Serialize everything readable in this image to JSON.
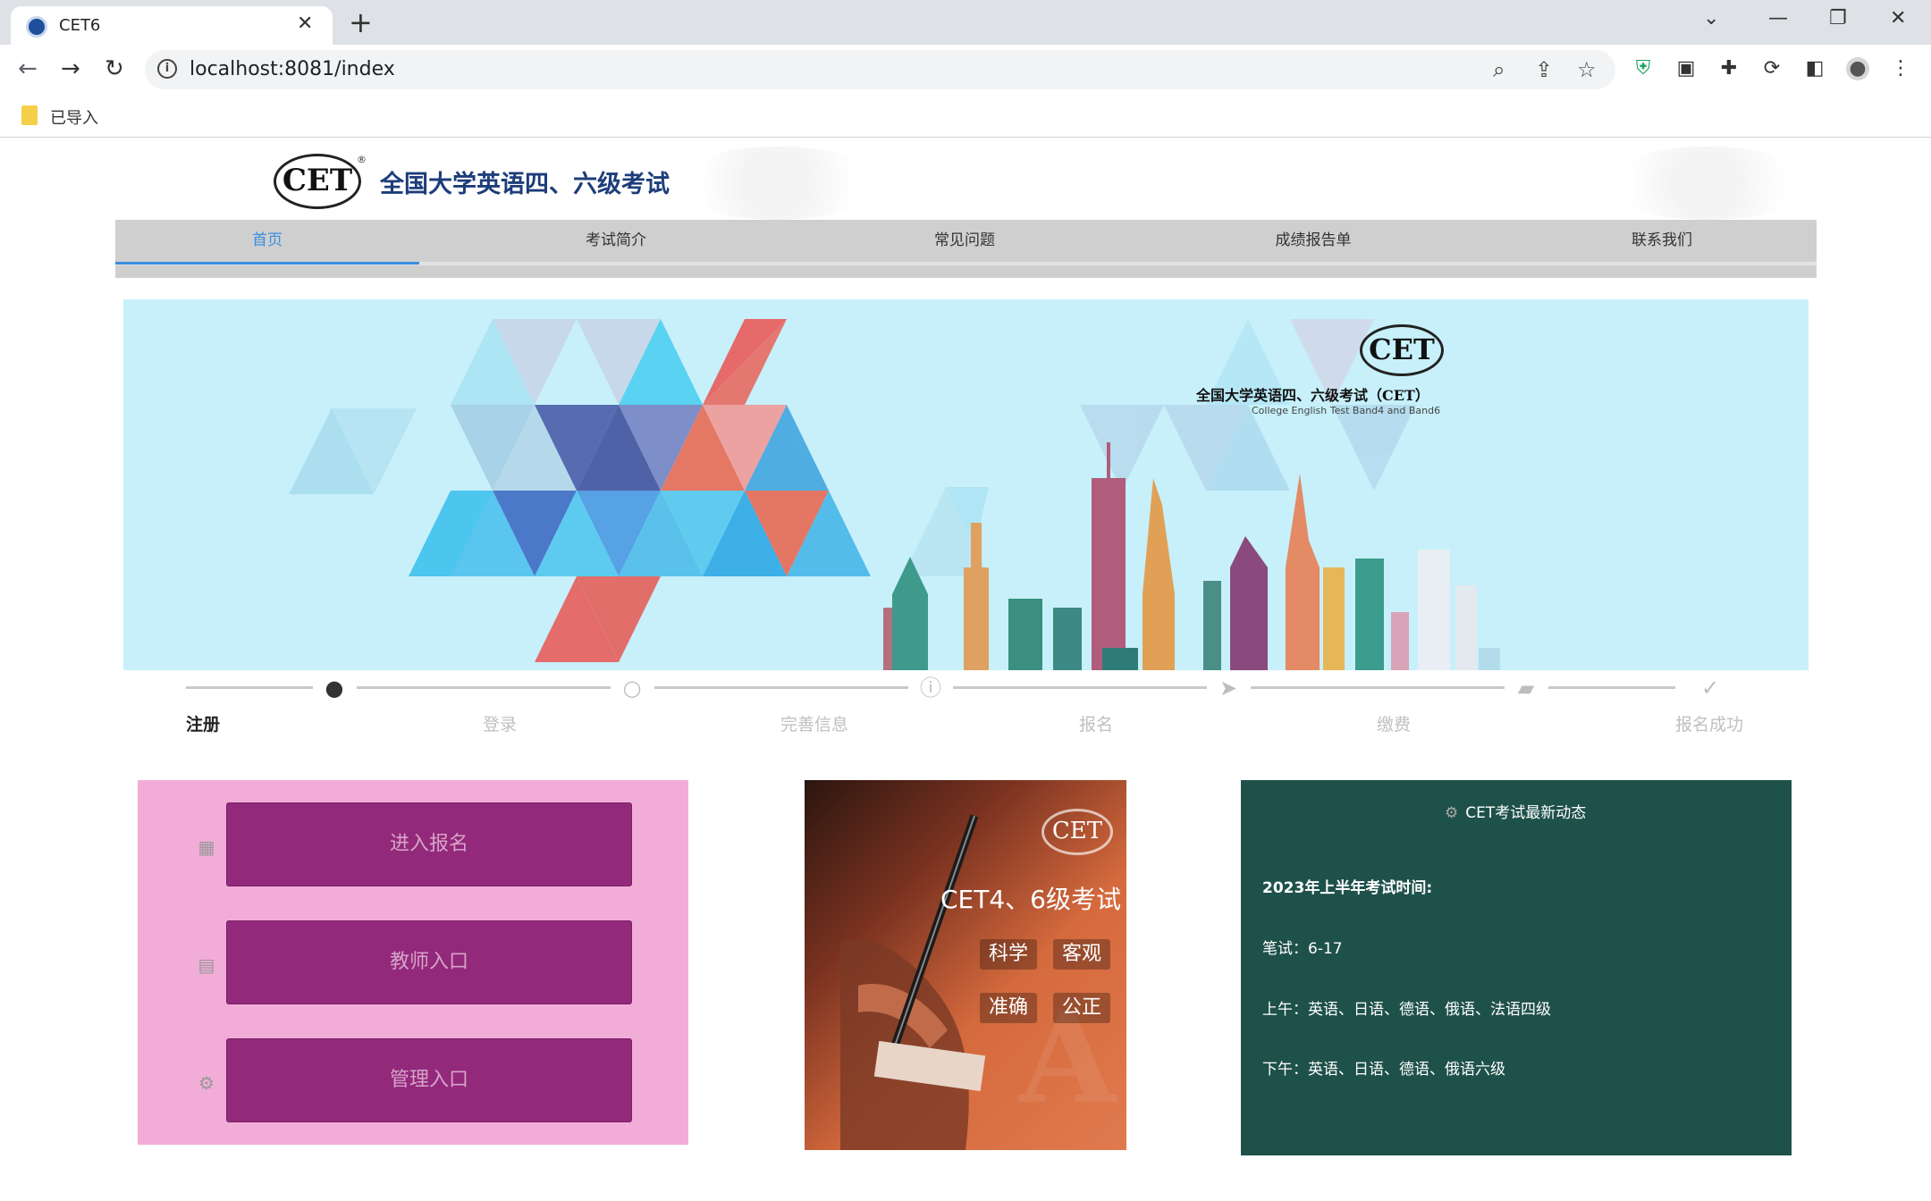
{
  "browser": {
    "tab_title": "CET6",
    "url": "localhost:8081/index",
    "bookmark_folder": "已导入"
  },
  "header": {
    "logo_text": "CET",
    "logo_mark": "®",
    "site_title": "全国大学英语四、六级考试"
  },
  "nav": {
    "items": [
      {
        "label": "首页",
        "active": true
      },
      {
        "label": "考试简介"
      },
      {
        "label": "常见问题"
      },
      {
        "label": "成绩报告单"
      },
      {
        "label": "联系我们"
      }
    ],
    "accent_color": "#3b8de0"
  },
  "banner": {
    "logo_text": "CET",
    "title": "全国大学英语四、六级考试（CET）",
    "subtitle": "College English Test Band4 and Band6"
  },
  "steps": [
    {
      "label": "注册",
      "icon": "user-icon",
      "done": true
    },
    {
      "label": "登录",
      "icon": "user-outline-icon",
      "done": false
    },
    {
      "label": "完善信息",
      "icon": "info-icon",
      "done": false
    },
    {
      "label": "报名",
      "icon": "send-icon",
      "done": false
    },
    {
      "label": "缴费",
      "icon": "wallet-icon",
      "done": false
    },
    {
      "label": "报名成功",
      "icon": "check-icon",
      "done": false
    }
  ],
  "entry": {
    "signup_label": "进入报名",
    "teacher_label": "教师入口",
    "admin_label": "管理入口",
    "panel_color": "#f1add8",
    "button_color": "#93297b"
  },
  "promo": {
    "logo_text": "CET",
    "title": "CET4、6级考试",
    "tags": [
      "科学",
      "客观",
      "准确",
      "公正"
    ]
  },
  "news": {
    "heading": "CET考试最新动态",
    "lines": [
      "2023年上半年考试时间:",
      "笔试：6-17",
      "上午：英语、日语、德语、俄语、法语四级",
      "下午：英语、日语、德语、俄语六级"
    ],
    "bg_color": "#1e514a"
  }
}
